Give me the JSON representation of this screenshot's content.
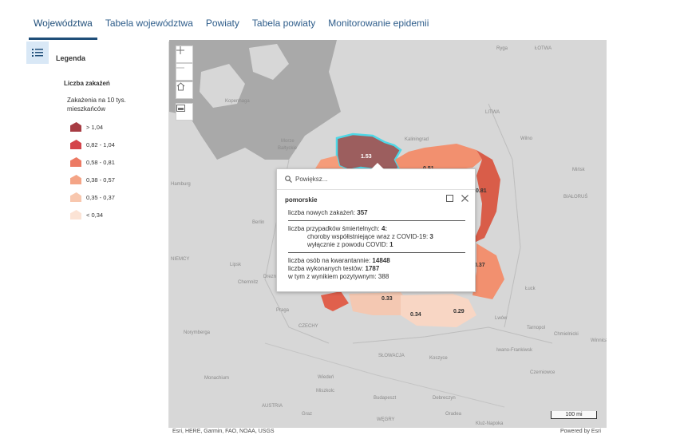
{
  "tabs": [
    "Województwa",
    "Tabela województwa",
    "Powiaty",
    "Tabela powiaty",
    "Monitorowanie epidemii"
  ],
  "legend": {
    "title": "Legenda",
    "layer": "Liczba zakażeń",
    "subtitle": "Zakażenia na 10 tys. mieszkańców",
    "items": [
      {
        "label": "> 1,04",
        "color": "#a73c43"
      },
      {
        "label": "0,82 - 1,04",
        "color": "#d4444b"
      },
      {
        "label": "0,58 - 0,81",
        "color": "#ec7a64"
      },
      {
        "label": "0,38 - 0,57",
        "color": "#f4a486"
      },
      {
        "label": "0,35 - 0,37",
        "color": "#f8c7ae"
      },
      {
        "label": "< 0,34",
        "color": "#fbe3d5"
      }
    ]
  },
  "map": {
    "place_labels": [
      "Ryga",
      "ŁOTWA",
      "Kaliningrad",
      "Kopenhaga",
      "Morze Bałtyckie",
      "LITWA",
      "Wilno",
      "Mińsk",
      "Hamburg",
      "Berlin",
      "Lipsk",
      "Drezno",
      "Chemnitz",
      "NIEMCY",
      "BIAŁORUŚ",
      "Łuck",
      "Praga",
      "CZECHY",
      "Lwów",
      "Tarnopol",
      "Chmielnicki",
      "Norymberga",
      "Iwano-Frankiwsk",
      "Winnica",
      "SŁOWACJA",
      "Koszyce",
      "Monachium",
      "Wiedeń",
      "Czerniowce",
      "AUSTRIA",
      "Miszkolc",
      "Budapeszt",
      "Debreczyn",
      "Graz",
      "WĘGRY",
      "Oradea",
      "Kluż-Napoka"
    ],
    "region_values": [
      "1.53",
      "0.51",
      "0.81",
      "0.37",
      "0.33",
      "0.34",
      "0.29"
    ],
    "scale_label": "100 mi",
    "attribution": "Esri, HERE, Garmin, FAO, NOAA, USGS",
    "powered_by": "Powered by Esri"
  },
  "popup": {
    "zoom_label": "Powiększ...",
    "region": "pomorskie",
    "new_cases_label": "liczba nowych zakażeń:",
    "new_cases": "357",
    "deaths_label": "liczba przypadków śmiertelnych:",
    "deaths": "4",
    "comorb_label": "choroby współistniejące wraz z COVID-19:",
    "comorb": "3",
    "covid_only_label": "wyłącznie z powodu COVID:",
    "covid_only": "1",
    "quarantine_label": "liczba osób na kwarantannie:",
    "quarantine": "14848",
    "tests_label": "liczba wykonanych testów:",
    "tests": "1787",
    "positive_label": "w tym z wynikiem pozytywnym:",
    "positive": "388"
  }
}
